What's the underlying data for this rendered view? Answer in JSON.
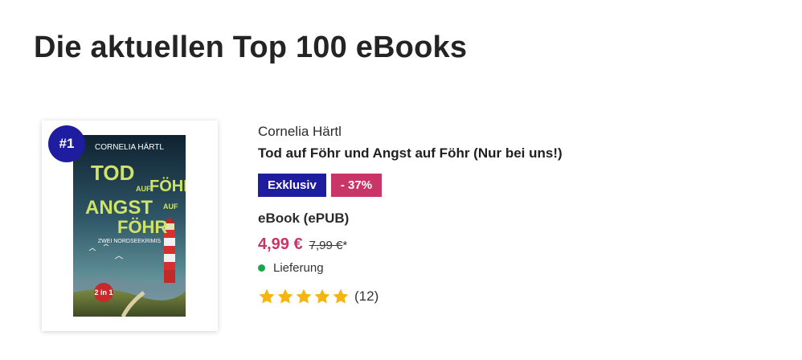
{
  "page": {
    "title": "Die aktuellen Top 100 eBooks"
  },
  "product": {
    "rank": "#1",
    "cover": {
      "author": "CORNELIA HÄRTL",
      "line1": "TOD",
      "line2_small": "AUF",
      "line2": "FÖHR",
      "line3": "ANGST",
      "line3_small": "AUF",
      "line4": "FÖHR",
      "subtitle": "ZWEI NORDSEEKRIMIS",
      "badge": "2 in 1"
    },
    "author": "Cornelia Härtl",
    "title": "Tod auf Föhr und Angst auf Föhr (Nur bei uns!)",
    "badges": {
      "exklusiv": "Exklusiv",
      "discount": "- 37%"
    },
    "format": "eBook (ePUB)",
    "price": "4,99 €",
    "old_price": "7,99 €",
    "price_note": "*",
    "delivery": "Lieferung",
    "rating": {
      "stars": 5,
      "max": 5,
      "count": "(12)"
    }
  },
  "colors": {
    "brand_blue": "#1e1c9f",
    "discount_pink": "#c83566",
    "price_pink": "#c83566",
    "delivery_green": "#1aa64a",
    "star_gold": "#f6b40e"
  },
  "icons": {
    "star": "star-icon",
    "delivery_dot": "status-dot-icon"
  }
}
